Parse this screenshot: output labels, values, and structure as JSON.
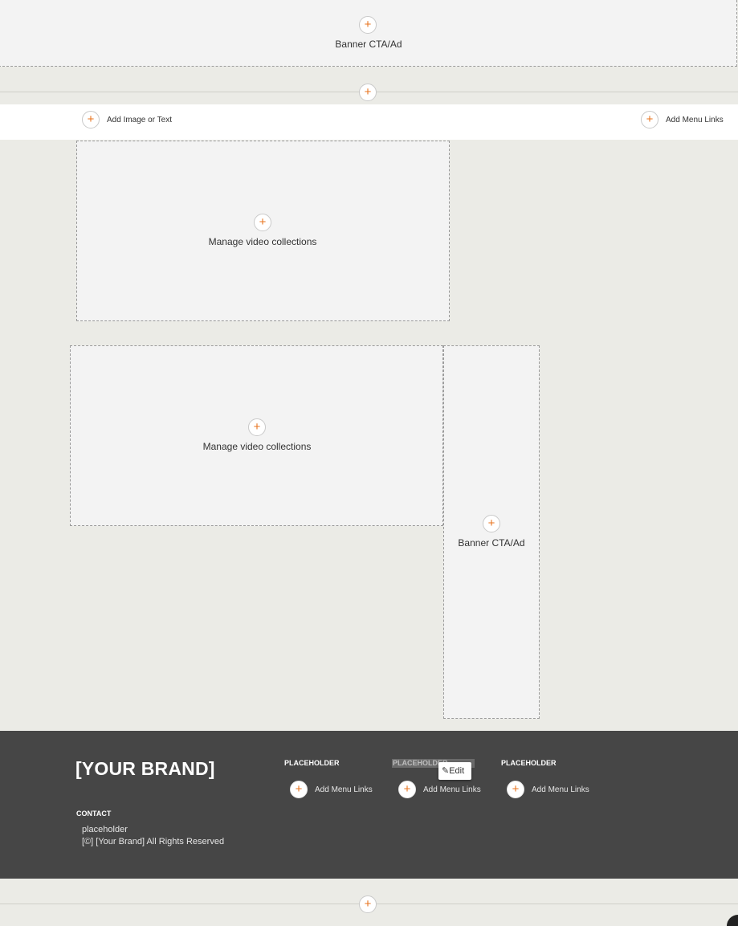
{
  "top_banner": {
    "label": "Banner CTA/Ad"
  },
  "nav_bar": {
    "left_label": "Add Image or Text",
    "right_label": "Add Menu Links"
  },
  "video_block_1": {
    "label": "Manage video collections"
  },
  "video_block_2": {
    "label": "Manage video collections"
  },
  "side_banner": {
    "label": "Banner CTA/Ad"
  },
  "footer": {
    "brand": "[YOUR BRAND]",
    "columns": [
      {
        "heading": "PLACEHOLDER",
        "menu_label": "Add Menu Links"
      },
      {
        "heading": "PLACEHOLDER",
        "menu_label": "Add Menu Links"
      },
      {
        "heading": "PLACEHOLDER",
        "menu_label": "Add Menu Links"
      }
    ],
    "edit_label": "Edit",
    "contact_heading": "CONTACT",
    "contact_text": "placeholder",
    "copyright": "[©] [Your Brand] All Rights Reserved"
  },
  "colors": {
    "accent": "#e8731e",
    "footer_bg": "#464646",
    "page_bg": "#ebebe6"
  },
  "icons": {
    "add": "plus-icon",
    "edit": "pencil-icon"
  }
}
